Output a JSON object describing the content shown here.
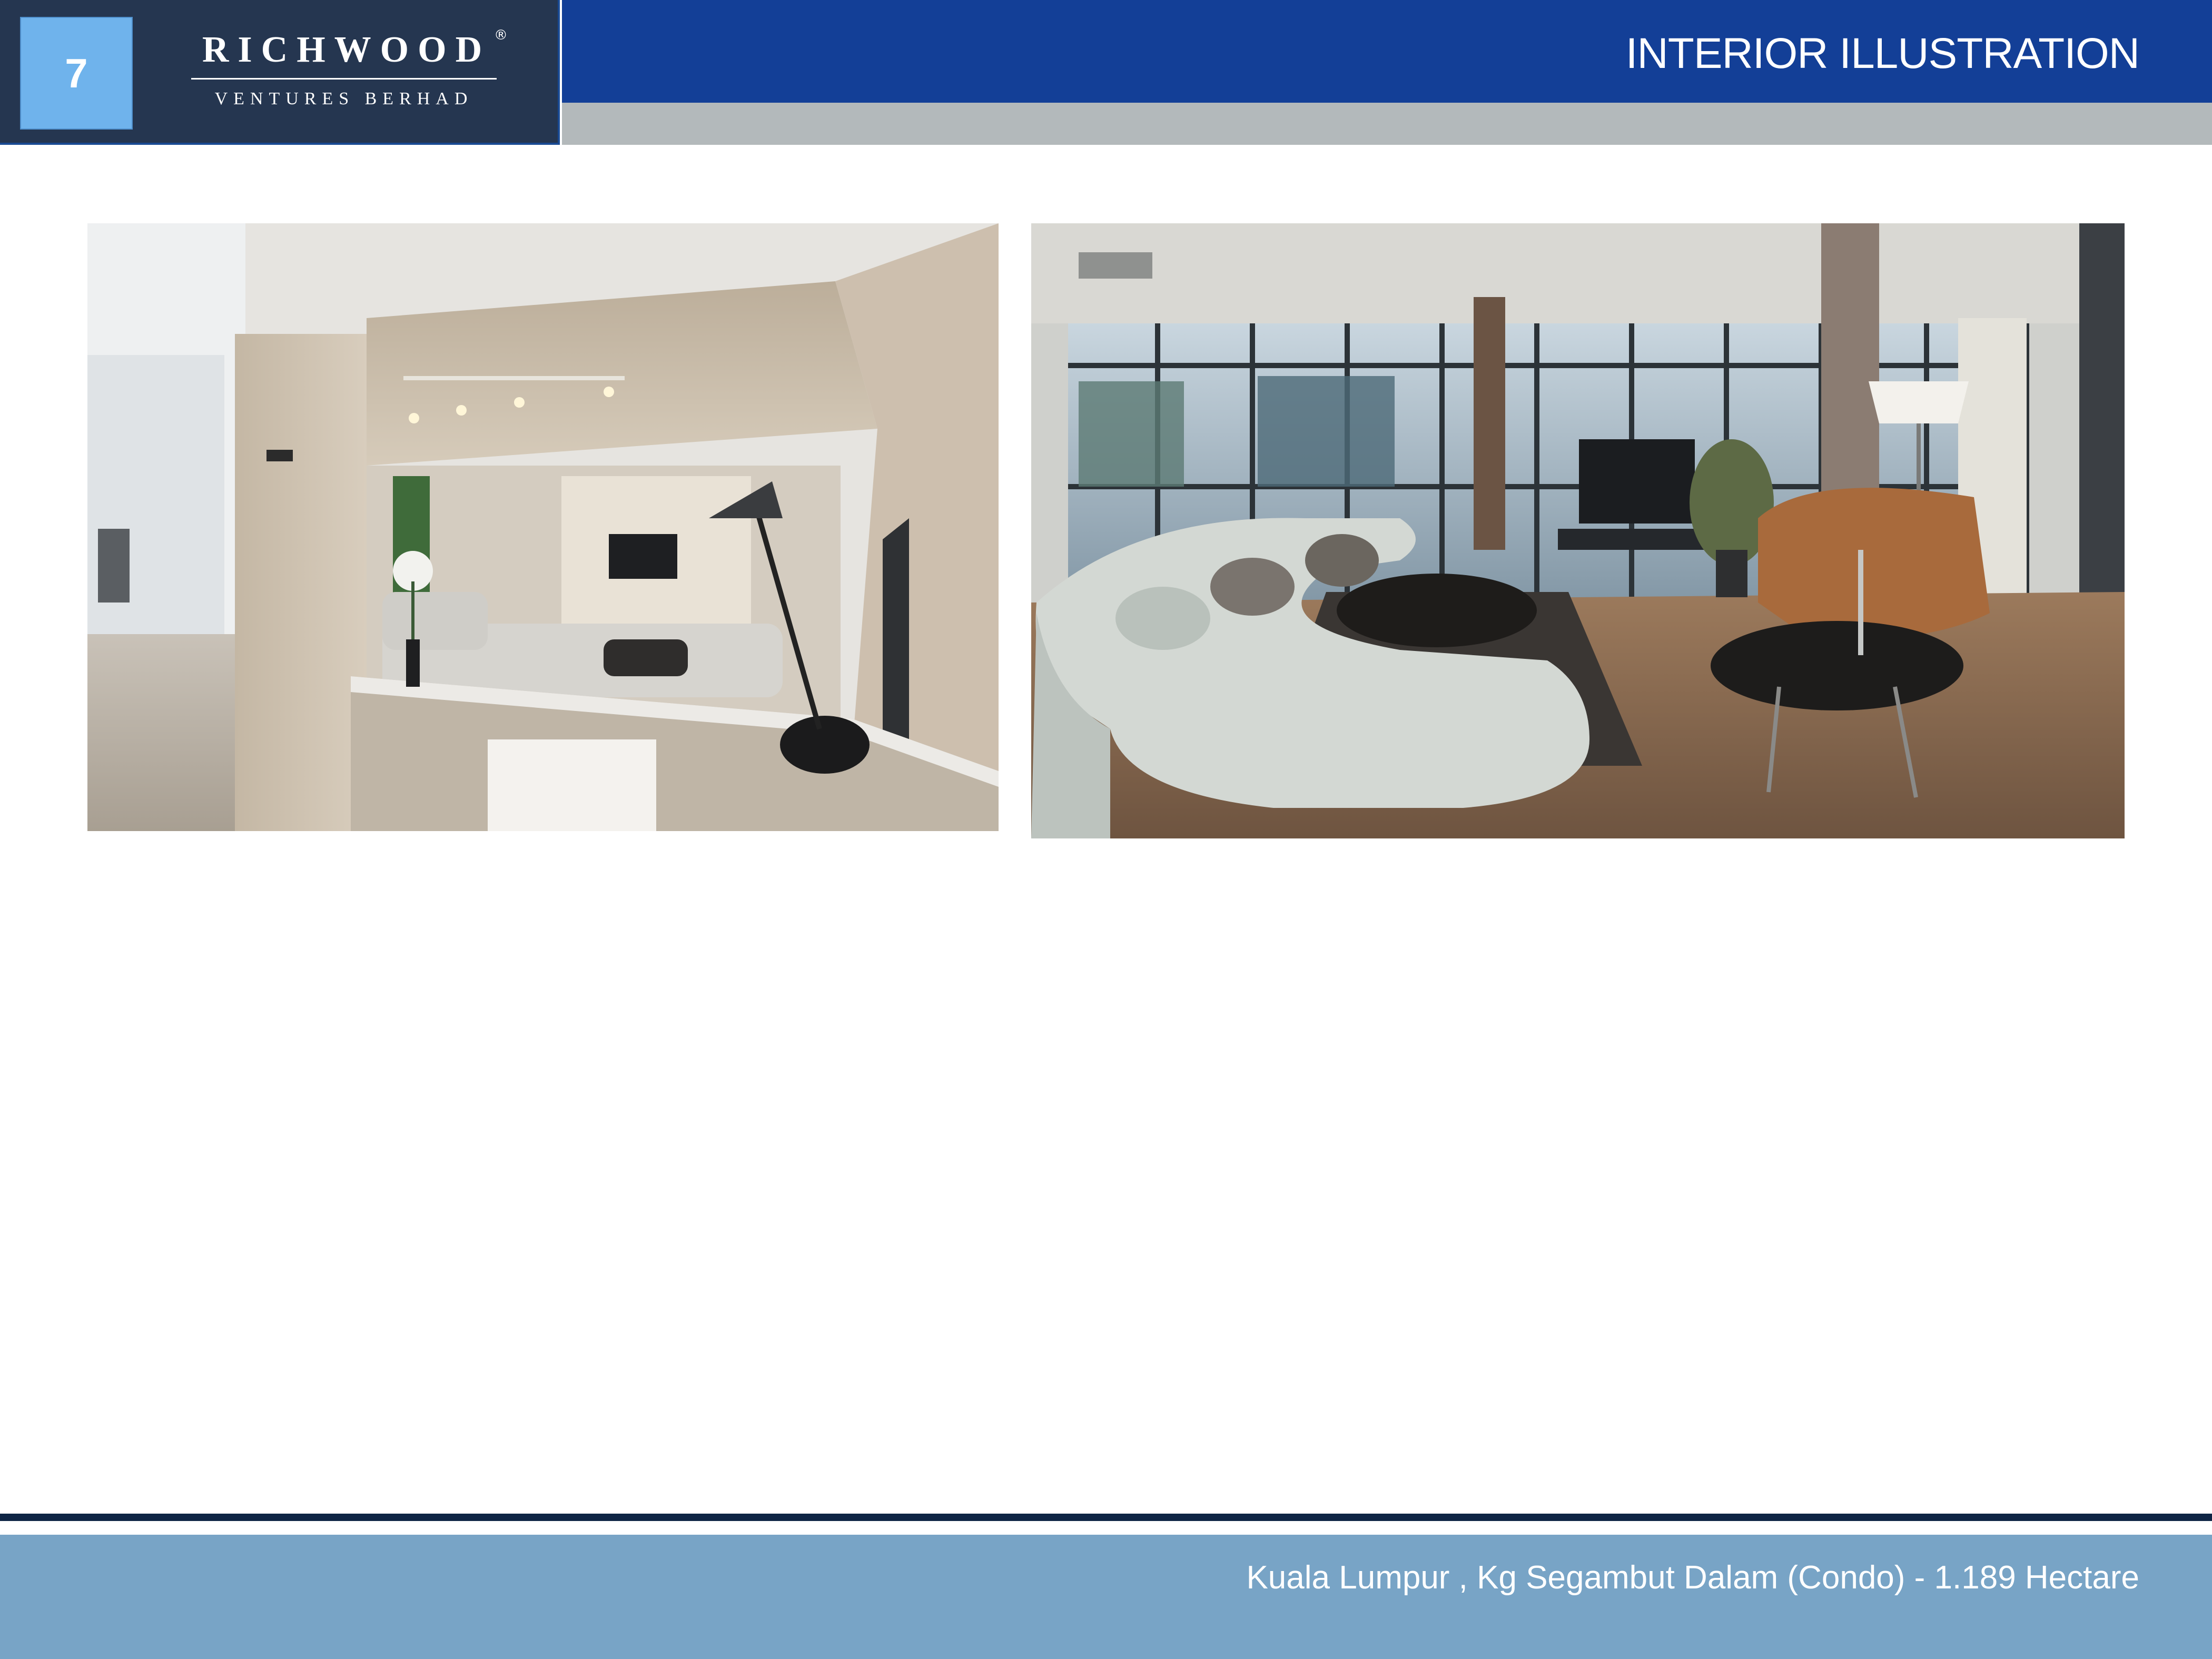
{
  "header": {
    "page_number": "7",
    "brand_name": "RICHWOOD",
    "brand_registered": "®",
    "brand_subtitle": "VENTURES BERHAD",
    "title": "INTERIOR ILLUSTRATION"
  },
  "photos": [
    {
      "name": "interior-photo-living-room-wood"
    },
    {
      "name": "interior-photo-living-room-windows"
    }
  ],
  "footer": {
    "location": "Kuala Lumpur , Kg Segambut Dalam (Condo) - 1.189 Hectare"
  },
  "colors": {
    "header_navy": "#253650",
    "title_blue": "#133f97",
    "page_badge": "#6fb3ec",
    "footer_blue": "#78a4c6",
    "grey_band": "#b3b9bb"
  }
}
